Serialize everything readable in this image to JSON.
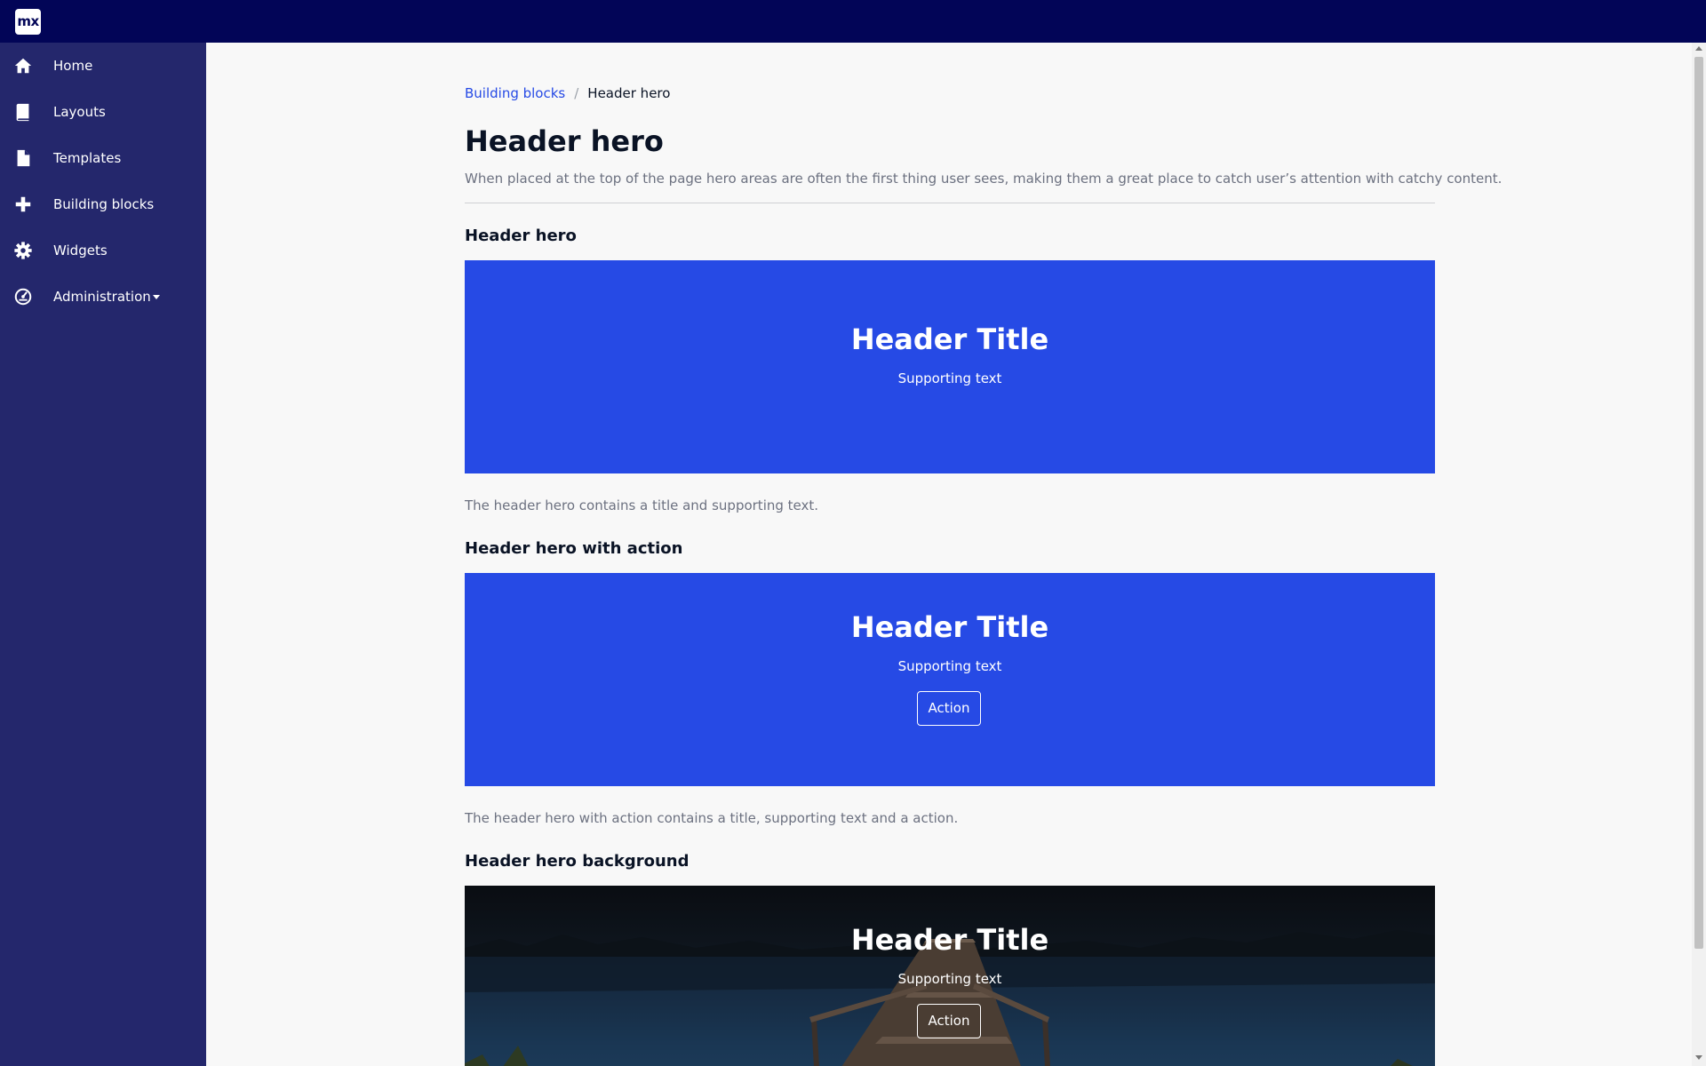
{
  "app": {
    "logo_text": "mx"
  },
  "sidebar": {
    "items": [
      {
        "label": "Home",
        "icon": "home-icon"
      },
      {
        "label": "Layouts",
        "icon": "book-icon"
      },
      {
        "label": "Templates",
        "icon": "file-icon"
      },
      {
        "label": "Building blocks",
        "icon": "plus-icon"
      },
      {
        "label": "Widgets",
        "icon": "gear-icon"
      },
      {
        "label": "Administration",
        "icon": "dashboard-icon",
        "has_dropdown": true
      }
    ]
  },
  "breadcrumb": {
    "parent": "Building blocks",
    "separator": "/",
    "current": "Header hero"
  },
  "page": {
    "title": "Header hero",
    "description": "When placed at the top of the page hero areas are often the first thing user sees, making them a great place to catch user’s attention with catchy content."
  },
  "sections": [
    {
      "title": "Header hero",
      "hero_title": "Header Title",
      "hero_subtitle": "Supporting text",
      "description": "The header hero contains a title and supporting text."
    },
    {
      "title": "Header hero with action",
      "hero_title": "Header Title",
      "hero_subtitle": "Supporting text",
      "action_label": "Action",
      "description": "The header hero with action contains a title, supporting text and a action."
    },
    {
      "title": "Header hero background",
      "hero_title": "Header Title",
      "hero_subtitle": "Supporting text",
      "action_label": "Action"
    }
  ],
  "colors": {
    "topbar": "#020557",
    "sidebar": "#24276c",
    "hero": "#264ae5",
    "link": "#264ae5"
  }
}
